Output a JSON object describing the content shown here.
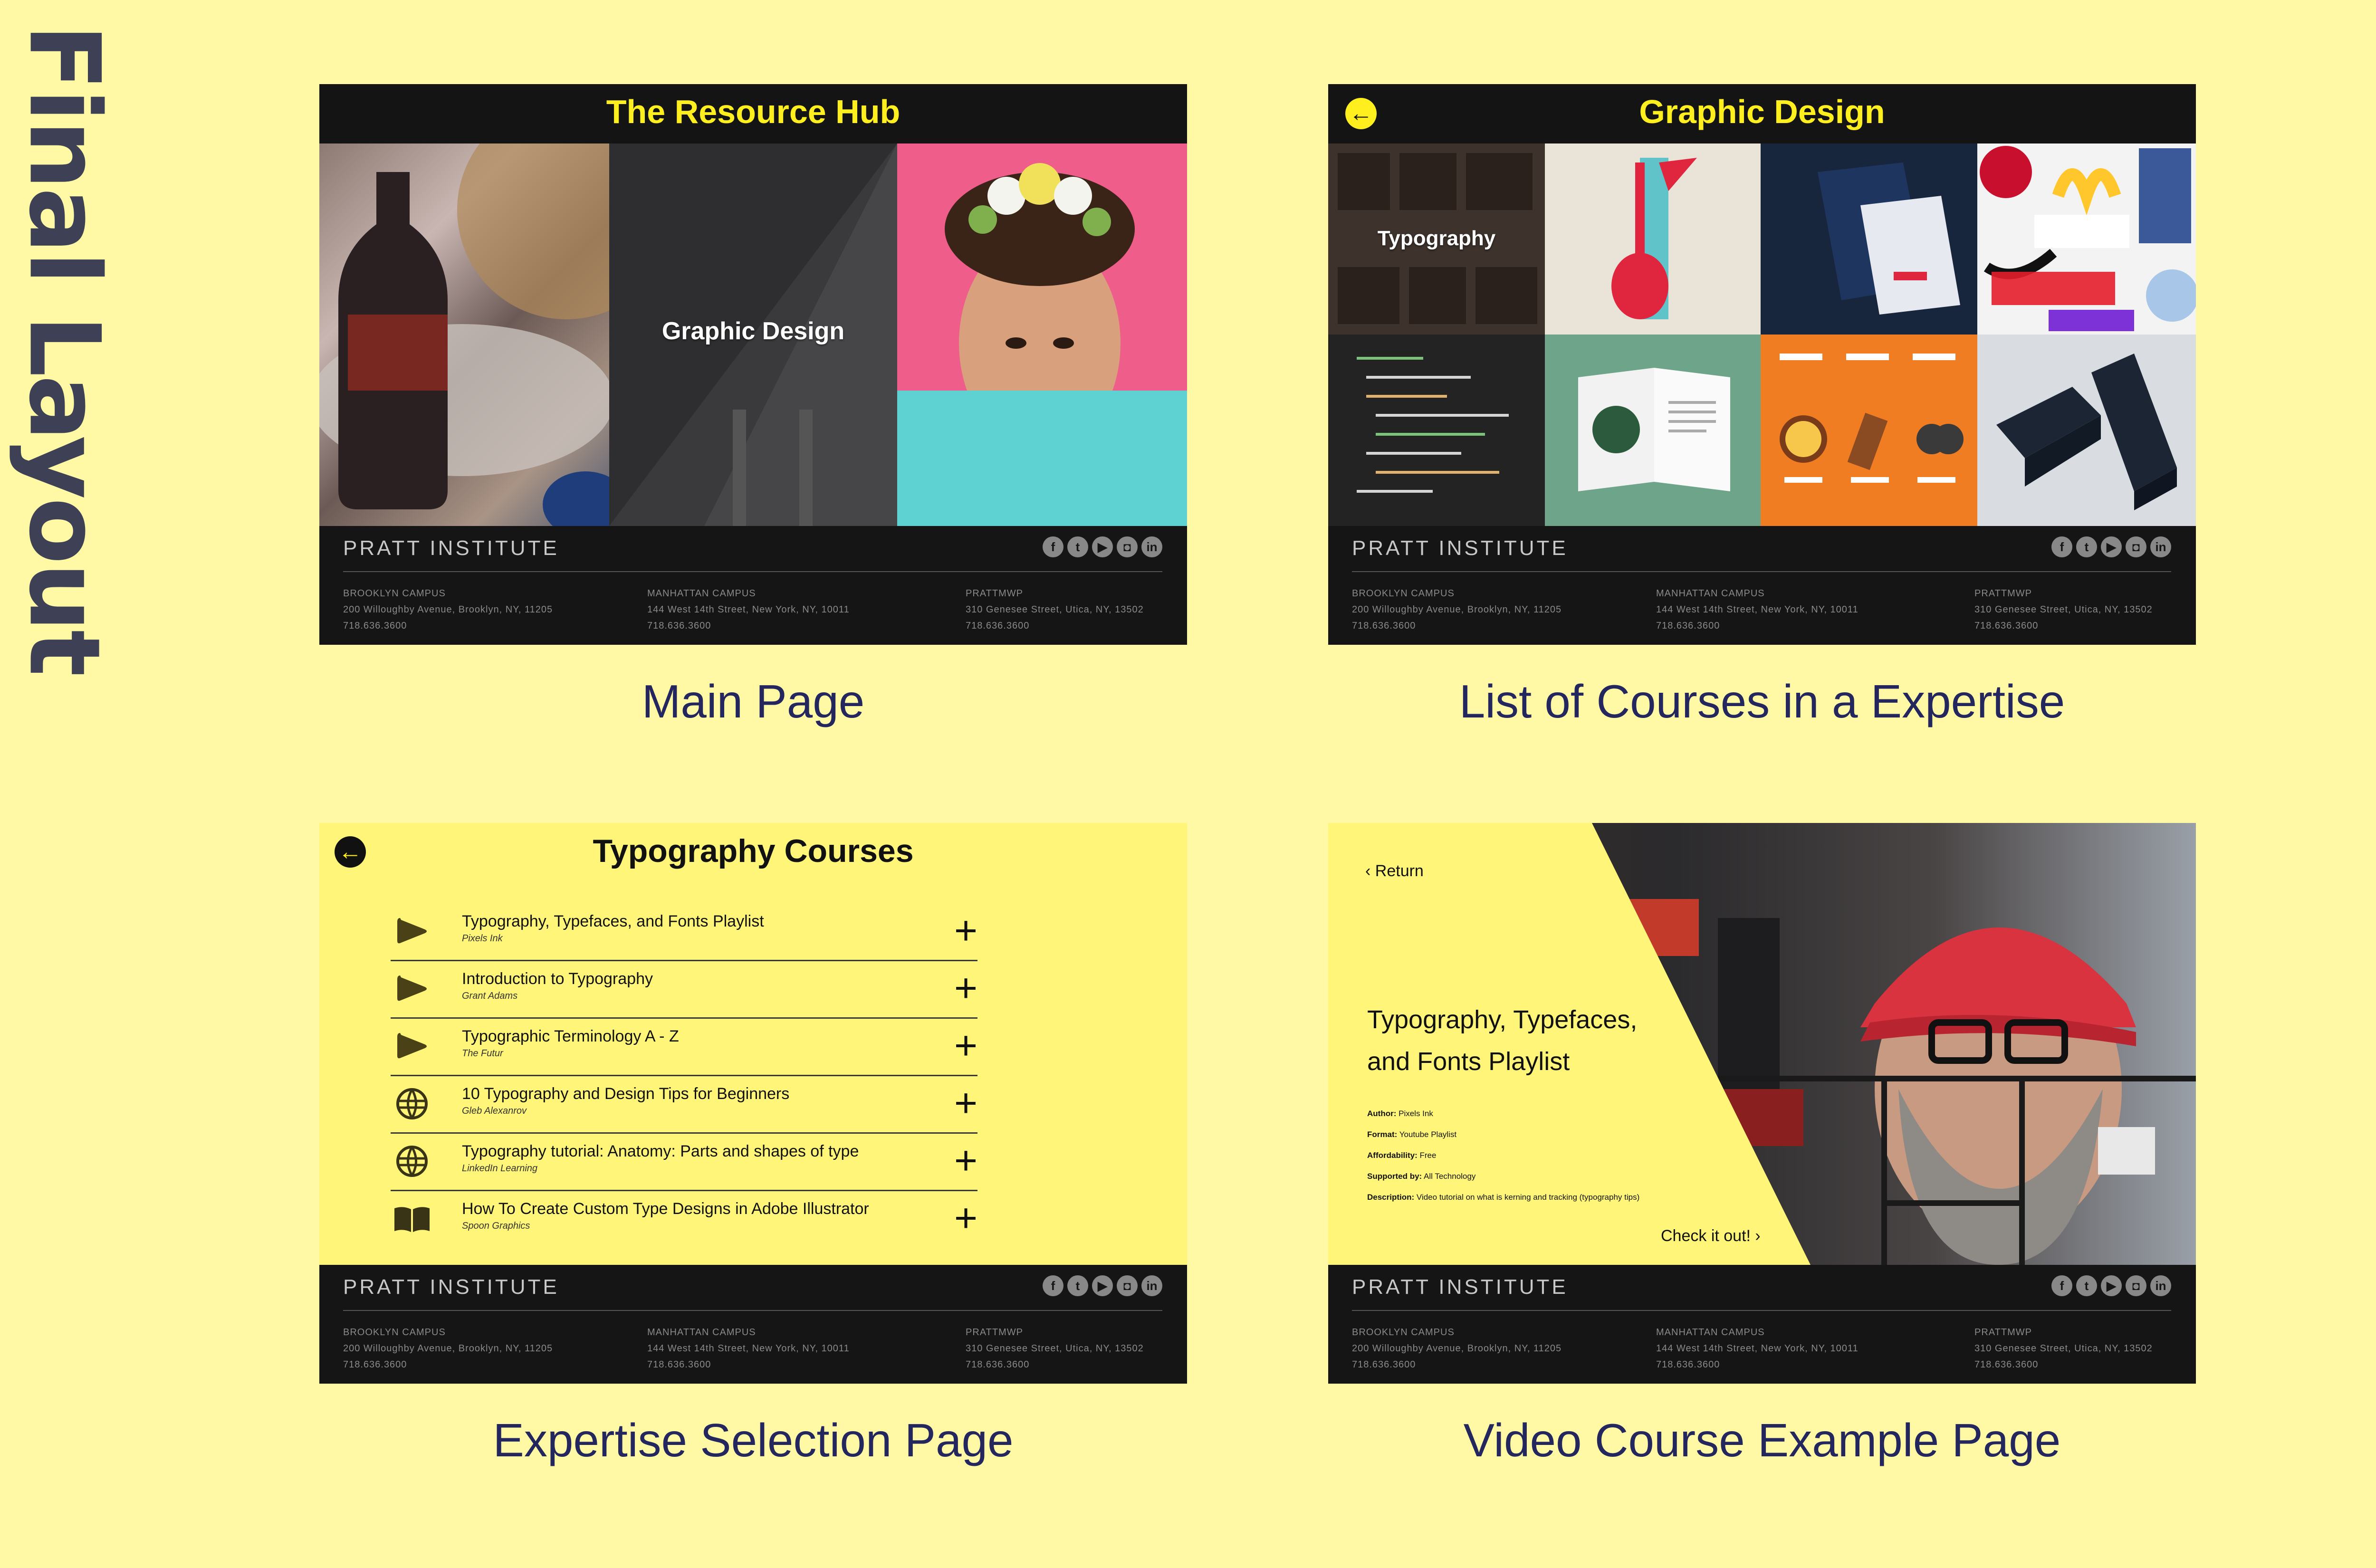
{
  "page_title": "Final Layout",
  "footer": {
    "brand": "PRATT INSTITUTE",
    "social_icons": [
      "facebook-icon",
      "twitter-icon",
      "youtube-icon",
      "instagram-icon",
      "linkedin-icon"
    ],
    "campuses": [
      {
        "name": "BROOKLYN CAMPUS",
        "address": "200 Willoughby Avenue, Brooklyn, NY, 11205",
        "phone": "718.636.3600"
      },
      {
        "name": "MANHATTAN CAMPUS",
        "address": "144 West 14th Street, New York, NY, 10011",
        "phone": "718.636.3600"
      },
      {
        "name": "PRATTMWP",
        "address": "310 Genesee Street, Utica, NY, 13502",
        "phone": "718.636.3600"
      }
    ]
  },
  "main_page": {
    "title": "The Resource Hub",
    "tile_label": "Graphic Design",
    "caption": "Main Page"
  },
  "list_page": {
    "title": "Graphic Design",
    "tile_label": "Typography",
    "caption": "List of Courses in a Expertise"
  },
  "selection_page": {
    "title": "Typography Courses",
    "caption": "Expertise Selection Page",
    "courses": [
      {
        "name": "Typography, Typefaces, and Fonts Playlist",
        "author": "Pixels Ink",
        "icon": "play-icon"
      },
      {
        "name": "Introduction to Typography",
        "author": "Grant Adams",
        "icon": "play-icon"
      },
      {
        "name": "Typographic Terminology A - Z",
        "author": "The Futur",
        "icon": "play-icon"
      },
      {
        "name": "10 Typography and Design Tips for Beginners",
        "author": "Gleb Alexanrov",
        "icon": "globe-icon"
      },
      {
        "name": "Typography tutorial: Anatomy: Parts and shapes of type",
        "author": "LinkedIn Learning",
        "icon": "globe-icon"
      },
      {
        "name": "How To Create Custom Type Designs in Adobe Illustrator",
        "author": "Spoon Graphics",
        "icon": "book-icon"
      }
    ]
  },
  "video_page": {
    "return_label": "Return",
    "title_line1": "Typography, Typefaces,",
    "title_line2": "and Fonts Playlist",
    "meta": {
      "author_label": "Author:",
      "author": "Pixels Ink",
      "format_label": "Format:",
      "format": "Youtube Playlist",
      "afford_label": "Affordability:",
      "afford": "Free",
      "support_label": "Supported by:",
      "support": "All Technology",
      "desc_label": "Description:",
      "desc": "Video tutorial on what is kerning and tracking (typography tips)"
    },
    "cta": "Check it out!",
    "caption": "Video Course Example Page"
  },
  "colors": {
    "accent": "#ffef1f",
    "page_bg": "#fff9a6",
    "caption": "#24265e",
    "dark": "#111111"
  }
}
